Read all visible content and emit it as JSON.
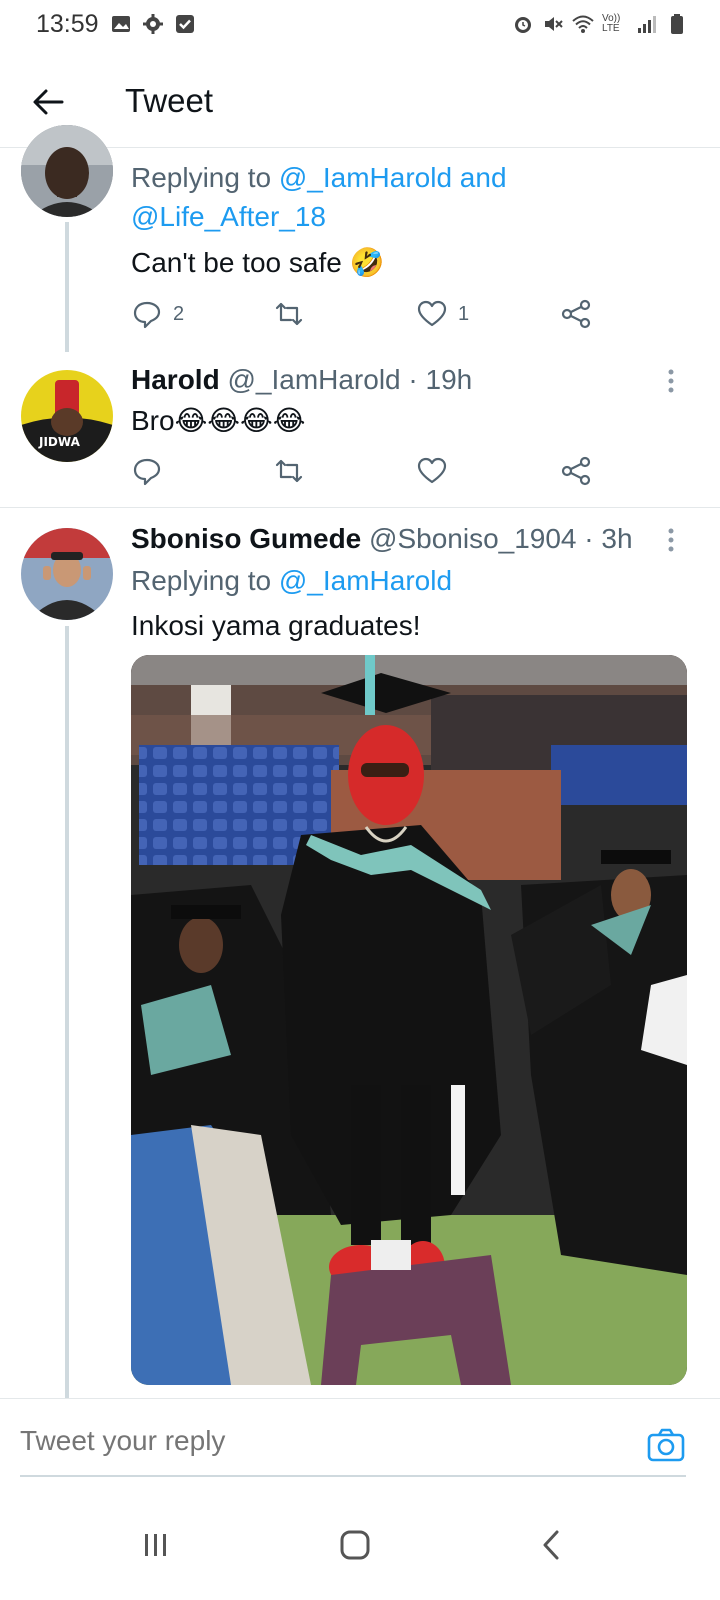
{
  "status_bar": {
    "time": "13:59",
    "left_icons": [
      "image-icon",
      "gear-icon",
      "check-box-icon"
    ],
    "right_icons": [
      "alarm-icon",
      "mute-icon",
      "wifi-icon",
      "volte-icon",
      "signal-icon",
      "battery-icon"
    ],
    "volte_text": "Vo)) LTE"
  },
  "header": {
    "title": "Tweet"
  },
  "tweets": [
    {
      "replying_prefix": "Replying to",
      "replying_to_line1": "@_IamHarold and",
      "replying_to_line2": "@Life_After_18",
      "text": "Can't be too safe 🤣",
      "reply_count": "2",
      "retweet_count": "",
      "like_count": "1"
    },
    {
      "name": "Harold",
      "handle": "@_IamHarold",
      "time": "· 19h",
      "text": "Bro😂😂😂😂",
      "reply_count": "",
      "retweet_count": "",
      "like_count": ""
    },
    {
      "name": "Sboniso Gumede",
      "handle": "@Sboniso_1904",
      "time": "· 3h",
      "replying_prefix": "Replying to",
      "replying_to": "@_IamHarold",
      "text": "Inkosi yama graduates!"
    }
  ],
  "reply_bar": {
    "placeholder": "Tweet your reply"
  },
  "colors": {
    "accent": "#1d9bf0",
    "muted": "#536471",
    "text": "#0f1419",
    "divider": "#e4e8ea"
  }
}
